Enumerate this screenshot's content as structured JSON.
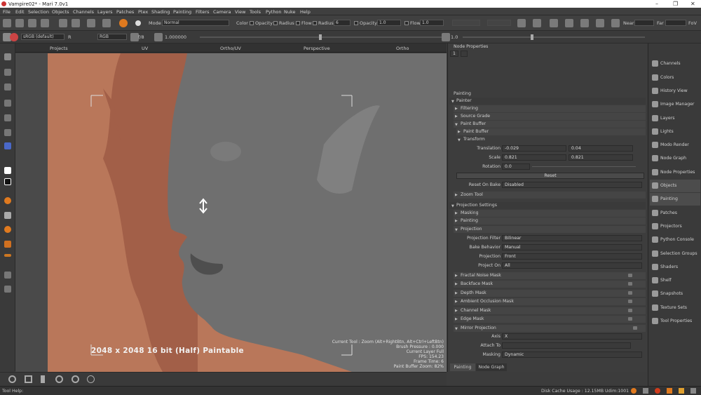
{
  "window": {
    "title": "Vampire02* - Mari 7.0v1",
    "min": "–",
    "max": "❐",
    "close": "✕"
  },
  "menu": [
    "File",
    "Edit",
    "Selection",
    "Objects",
    "Channels",
    "Layers",
    "Patches",
    "Ptex",
    "Shading",
    "Painting",
    "Filters",
    "Camera",
    "View",
    "Tools",
    "Python",
    "Nuke",
    "Help"
  ],
  "toolbar": {
    "mode_label": "Mode",
    "mode_value": "Normal",
    "color_label": "Color",
    "opacity_label": "Opacity",
    "radius_label": "Radius",
    "flow_label": "Flow",
    "radius2_label": "Radius",
    "radius2_value": "6",
    "opacity2_label": "Opacity",
    "opacity2_value": "1.0",
    "flow2_label": "Flow",
    "flow2_value": "1.0",
    "near_label": "Near",
    "far_label": "Far",
    "fov_label": "FoV"
  },
  "toolbar2": {
    "colorspace": "sRGB (default)",
    "r_label": "R",
    "channel": "RGB",
    "fstop": "f/8",
    "gain": "1.000000",
    "gamma": "1.0"
  },
  "viewport_tabs": [
    "Projects",
    "UV",
    "Ortho/UV",
    "Perspective",
    "Ortho"
  ],
  "viewport": {
    "paintable": "2048 x 2048 16 bit (Half) Paintable",
    "info": [
      "Current Tool : Zoom (Alt+RightBtn, Alt+Ctrl+LeftBtn)",
      "Brush Pressure : 0.000",
      "Current Layer Full",
      "FPS: 154.23",
      "Frame Time: 6",
      "Paint Buffer Zoom: 82%"
    ]
  },
  "node_properties": {
    "title": "Node Properties",
    "value": "1"
  },
  "painting_panel": {
    "title": "Painting",
    "painter": "Painter",
    "filtering": "Filtering",
    "source_grade": "Source Grade",
    "paint_buffer": "Paint Buffer",
    "paint_buffer_sub": "Paint Buffer",
    "transform": "Transform",
    "translation_label": "Translation",
    "translation_x": "-0.029",
    "translation_y": "0.04",
    "scale_label": "Scale",
    "scale_x": "0.821",
    "scale_y": "0.821",
    "rotation_label": "Rotation",
    "rotation_value": "0.0",
    "reset": "Reset",
    "reset_on_bake_label": "Reset On Bake",
    "reset_on_bake_value": "Disabled",
    "zoom_tool": "Zoom Tool",
    "projection_settings": "Projection Settings",
    "masking": "Masking",
    "painting": "Painting",
    "projection": "Projection",
    "projection_filter_label": "Projection Filter",
    "projection_filter_value": "Bilinear",
    "bake_behavior_label": "Bake Behavior",
    "bake_behavior_value": "Manual",
    "projection_label": "Projection",
    "projection_value": "Front",
    "project_on_label": "Project On",
    "project_on_value": "All",
    "fractal_noise_mask": "Fractal Noise Mask",
    "backface_mask": "Backface Mask",
    "depth_mask": "Depth Mask",
    "ambient_occlusion_mask": "Ambient Occlusion Mask",
    "channel_mask": "Channel Mask",
    "edge_mask": "Edge Mask",
    "mirror_projection": "Mirror Projection",
    "axis_label": "Axis",
    "axis_value": "X",
    "attach_to_label": "Attach To",
    "attach_to_value": "",
    "masking_label": "Masking",
    "masking_value": "Dynamic"
  },
  "bottom_tabs": [
    "Painting",
    "Node Graph"
  ],
  "shelf": [
    "Channels",
    "Colors",
    "History View",
    "Image Manager",
    "Layers",
    "Lights",
    "Modo Render",
    "Node Graph",
    "Node Properties",
    "Objects",
    "Painting",
    "Patches",
    "Projectors",
    "Python Console",
    "Selection Groups",
    "Shaders",
    "Shelf",
    "Snapshots",
    "Texture Sets",
    "Tool Properties"
  ],
  "status": {
    "tool_help": "Tool Help:",
    "disk_cache": "Disk Cache Usage : 12.15MB  Udim:1001"
  },
  "colors": {
    "skin": "#6f6f6f",
    "backdrop": "#b9775a",
    "backdrop_dark": "#a25f48",
    "accent": "#e07a1f"
  }
}
